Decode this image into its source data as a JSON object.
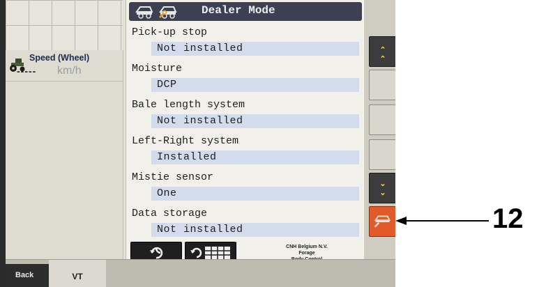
{
  "header": {
    "title": "Dealer Mode"
  },
  "speed": {
    "label": "Speed (Wheel)",
    "value": "-----",
    "unit": "km/h"
  },
  "settings": [
    {
      "label": "Pick-up stop",
      "value": "Not installed"
    },
    {
      "label": "Moisture",
      "value": "DCP"
    },
    {
      "label": "Bale length system",
      "value": "Not installed"
    },
    {
      "label": "Left-Right system",
      "value": "Installed"
    },
    {
      "label": "Mistie sensor",
      "value": "One"
    },
    {
      "label": "Data storage",
      "value": "Not installed"
    }
  ],
  "footer": {
    "company_lines": [
      "CNH Belgium N.V.",
      "Forage",
      "Body Control"
    ]
  },
  "bottom_bar": {
    "back_label": "Back",
    "vt_label": "VT"
  },
  "softkeys": [
    "page-up",
    "blank",
    "blank",
    "blank",
    "page-down",
    "dealer-mode"
  ],
  "callout": {
    "number": "12"
  },
  "colors": {
    "title_bar": "#3d4052",
    "value_highlight": "#d3dcec",
    "dealer_key": "#e05a2a"
  }
}
